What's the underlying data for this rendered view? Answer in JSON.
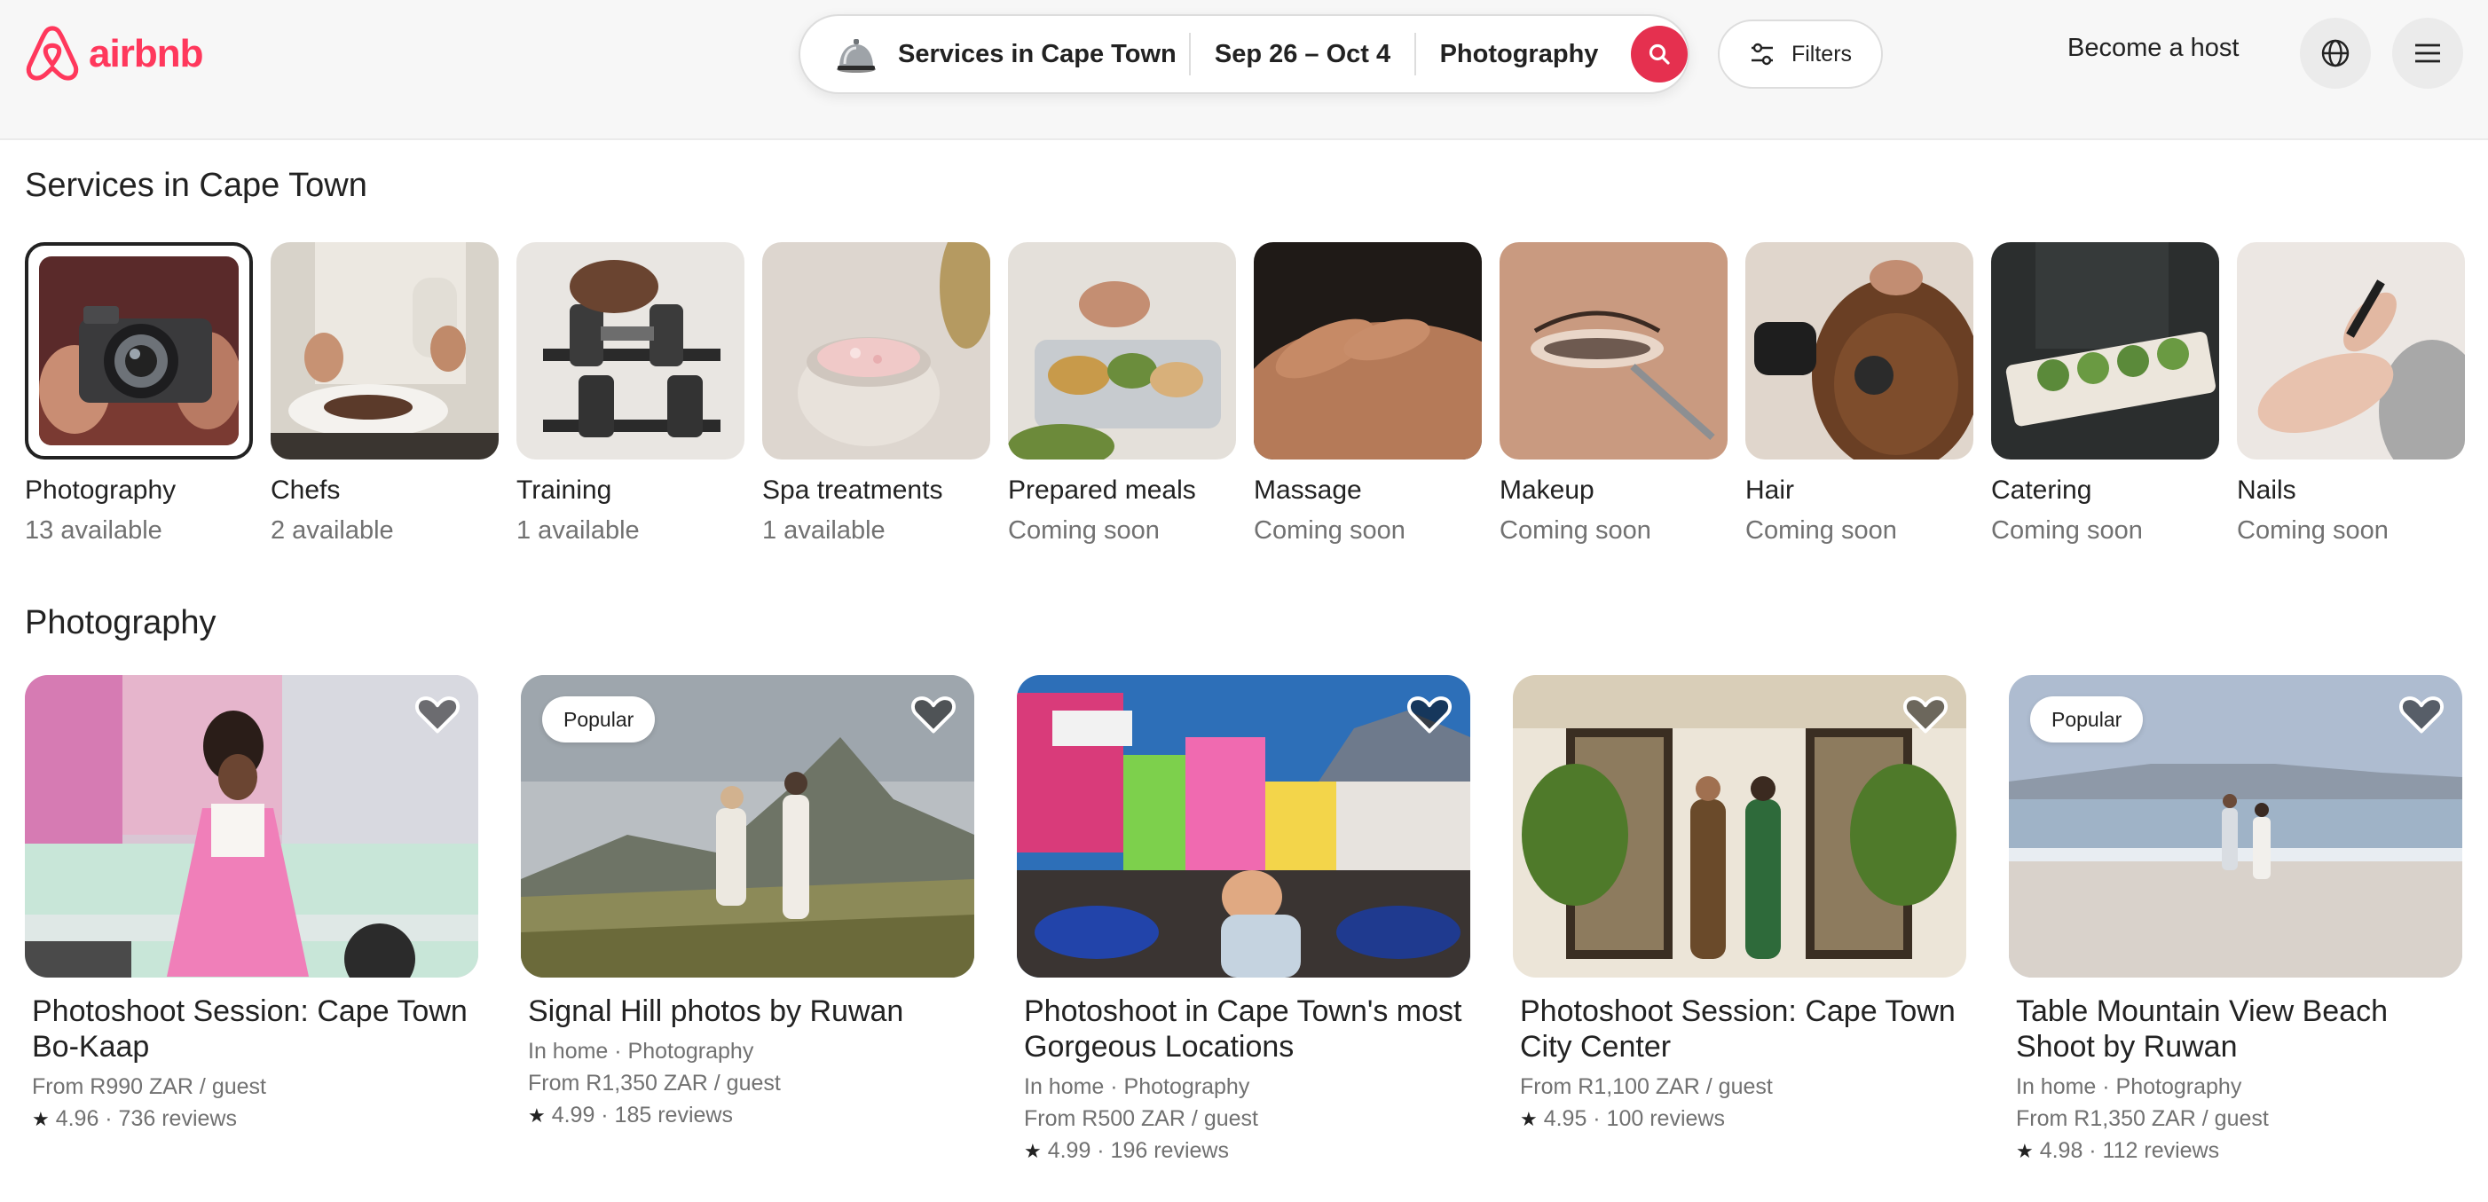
{
  "brand": {
    "name": "airbnb",
    "color": "#ff385c"
  },
  "search": {
    "location": "Services in Cape Town",
    "dates": "Sep 26 – Oct 4",
    "service_type": "Photography"
  },
  "header": {
    "filters_label": "Filters",
    "host_label": "Become a host"
  },
  "services": {
    "title": "Services in Cape Town",
    "categories": [
      {
        "name": "Photography",
        "status": "13 available"
      },
      {
        "name": "Chefs",
        "status": "2 available"
      },
      {
        "name": "Training",
        "status": "1 available"
      },
      {
        "name": "Spa treatments",
        "status": "1 available"
      },
      {
        "name": "Prepared meals",
        "status": "Coming soon"
      },
      {
        "name": "Massage",
        "status": "Coming soon"
      },
      {
        "name": "Makeup",
        "status": "Coming soon"
      },
      {
        "name": "Hair",
        "status": "Coming soon"
      },
      {
        "name": "Catering",
        "status": "Coming soon"
      },
      {
        "name": "Nails",
        "status": "Coming soon"
      }
    ]
  },
  "photography": {
    "title": "Photography",
    "listings": [
      {
        "title": "Photoshoot Session: Cape Town Bo-Kaap",
        "badge": "",
        "meta": "",
        "price": "From R990 ZAR / guest",
        "rating": "4.96 · 736 reviews"
      },
      {
        "title": "Signal Hill photos by Ruwan",
        "badge": "Popular",
        "meta": "In home · Photography",
        "price": "From R1,350 ZAR / guest",
        "rating": "4.99 · 185 reviews"
      },
      {
        "title": "Photoshoot in Cape Town's most Gorgeous Locations",
        "badge": "",
        "meta": "In home · Photography",
        "price": "From R500 ZAR / guest",
        "rating": "4.99 · 196 reviews"
      },
      {
        "title": "Photoshoot Session: Cape Town City Center",
        "badge": "",
        "meta": "",
        "price": "From R1,100 ZAR / guest",
        "rating": "4.95 · 100 reviews"
      },
      {
        "title": "Table Mountain View Beach Shoot by Ruwan",
        "badge": "Popular",
        "meta": "In home · Photography",
        "price": "From R1,350 ZAR / guest",
        "rating": "4.98 · 112 reviews"
      }
    ]
  }
}
